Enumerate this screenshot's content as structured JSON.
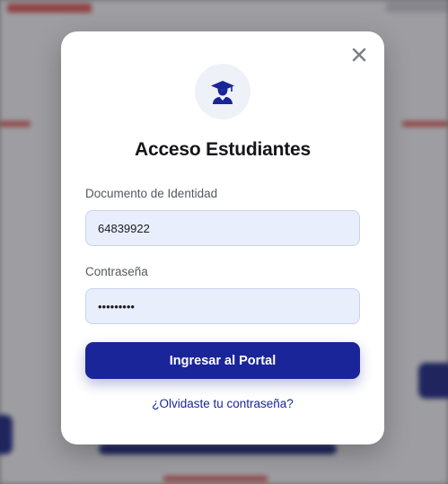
{
  "modal": {
    "title": "Acceso Estudiantes",
    "document_label": "Documento de Identidad",
    "document_value": "64839922",
    "password_label": "Contraseña",
    "password_value": "123456789",
    "submit_label": "Ingresar al Portal",
    "forgot_link": "¿Olvidaste tu contraseña?",
    "header_icon": "graduate-icon",
    "close_icon": "close-icon"
  },
  "colors": {
    "accent": "#1a2599",
    "field_bg": "#e8eefc",
    "icon_circle_bg": "#eef1f8"
  }
}
